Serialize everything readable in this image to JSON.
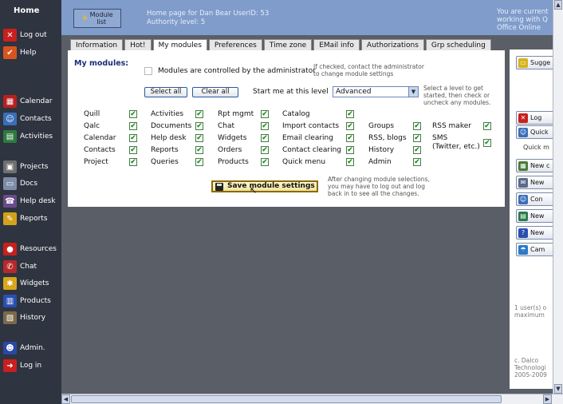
{
  "sidebar": {
    "home": "Home",
    "items": [
      {
        "label": "Log out",
        "icon": "close-icon",
        "glyph": "✕",
        "color": "#c8201e"
      },
      {
        "label": "Help",
        "icon": "help-icon",
        "glyph": "✔",
        "color": "#d8541e"
      },
      {
        "label": "Calendar",
        "icon": "calendar-icon",
        "glyph": "▦",
        "color": "#b72020"
      },
      {
        "label": "Contacts",
        "icon": "contacts-icon",
        "glyph": "☺",
        "color": "#3a6fb8"
      },
      {
        "label": "Activities",
        "icon": "activities-icon",
        "glyph": "▤",
        "color": "#2d7a3e"
      },
      {
        "label": "Projects",
        "icon": "projects-icon",
        "glyph": "▣",
        "color": "#6f6f6f"
      },
      {
        "label": "Docs",
        "icon": "docs-icon",
        "glyph": "▭",
        "color": "#7d8da8"
      },
      {
        "label": "Help desk",
        "icon": "helpdesk-icon",
        "glyph": "☎",
        "color": "#6a4a8a"
      },
      {
        "label": "Reports",
        "icon": "reports-icon",
        "glyph": "✎",
        "color": "#d1a21a"
      },
      {
        "label": "Resources",
        "icon": "resources-icon",
        "glyph": "●",
        "color": "#c8201e"
      },
      {
        "label": "Chat",
        "icon": "chat-icon",
        "glyph": "✆",
        "color": "#b52a2a"
      },
      {
        "label": "Widgets",
        "icon": "widgets-icon",
        "glyph": "✱",
        "color": "#d8a61a"
      },
      {
        "label": "Products",
        "icon": "products-icon",
        "glyph": "▥",
        "color": "#2a4fb0"
      },
      {
        "label": "History",
        "icon": "history-icon",
        "glyph": "▧",
        "color": "#7a6a4a"
      },
      {
        "label": "Admin.",
        "icon": "admin-icon",
        "glyph": "☻",
        "color": "#2a48a8"
      },
      {
        "label": "Log in",
        "icon": "login-icon",
        "glyph": "➜",
        "color": "#c8201e"
      }
    ]
  },
  "header": {
    "module_list_line1": "Module",
    "module_list_line2": "list",
    "home_page_text": "Home page for Dan Bear UserID: 53",
    "authority_text": "Authority level: 5",
    "right_line1": "You are current",
    "right_line2": "working with Q",
    "right_line3": "Office Online"
  },
  "tabs": [
    {
      "label": "Information",
      "active": false
    },
    {
      "label": "Hot!",
      "active": false
    },
    {
      "label": "My modules",
      "active": true
    },
    {
      "label": "Preferences",
      "active": false
    },
    {
      "label": "Time zone",
      "active": false
    },
    {
      "label": "EMail info",
      "active": false
    },
    {
      "label": "Authorizations",
      "active": false
    },
    {
      "label": "Grp scheduling",
      "active": false
    }
  ],
  "panel": {
    "title": "My modules:",
    "admin_control_label": "Modules are controlled by the administrator",
    "admin_hint_line1": "If checked, contact the administrator",
    "admin_hint_line2": "to change module settings",
    "select_all": "Select all",
    "clear_all": "Clear all",
    "start_level_label": "Start me at this level",
    "level_value": "Advanced",
    "level_hint_line1": "Select a level to get",
    "level_hint_line2": "started, then check or",
    "level_hint_line3": "uncheck any modules.",
    "save_button": "Save module settings",
    "save_hint_line1": "After changing module selections,",
    "save_hint_line2": "you may have to log out and log",
    "save_hint_line3": "back in to see all the changes."
  },
  "modules": [
    [
      "Quill",
      "Activities",
      "Rpt mgmt",
      "Catalog"
    ],
    [
      "Qalc",
      "Documents",
      "Chat",
      "Import contacts",
      "Groups",
      "RSS maker"
    ],
    [
      "Calendar",
      "Help desk",
      "Widgets",
      "Email clearing",
      "RSS, blogs",
      "SMS"
    ],
    [
      "Contacts",
      "Reports",
      "Orders",
      "Contact clearing",
      "History"
    ],
    [
      "Project",
      "Queries",
      "Products",
      "Quick menu",
      "Admin"
    ]
  ],
  "sms_second_line": "(Twitter, etc.)",
  "right_panel": {
    "suggest": "Sugge",
    "log": "Log",
    "quick": "Quick",
    "quick_menu": "Quick m",
    "items": [
      "New c",
      "New",
      "Con",
      "New",
      "New",
      "Cam"
    ],
    "users_line1": "1 user(s) o",
    "users_line2": "maximum",
    "copyright_line1": "c. Dalco",
    "copyright_line2": "Technologi",
    "copyright_line3": "2005-2009"
  }
}
